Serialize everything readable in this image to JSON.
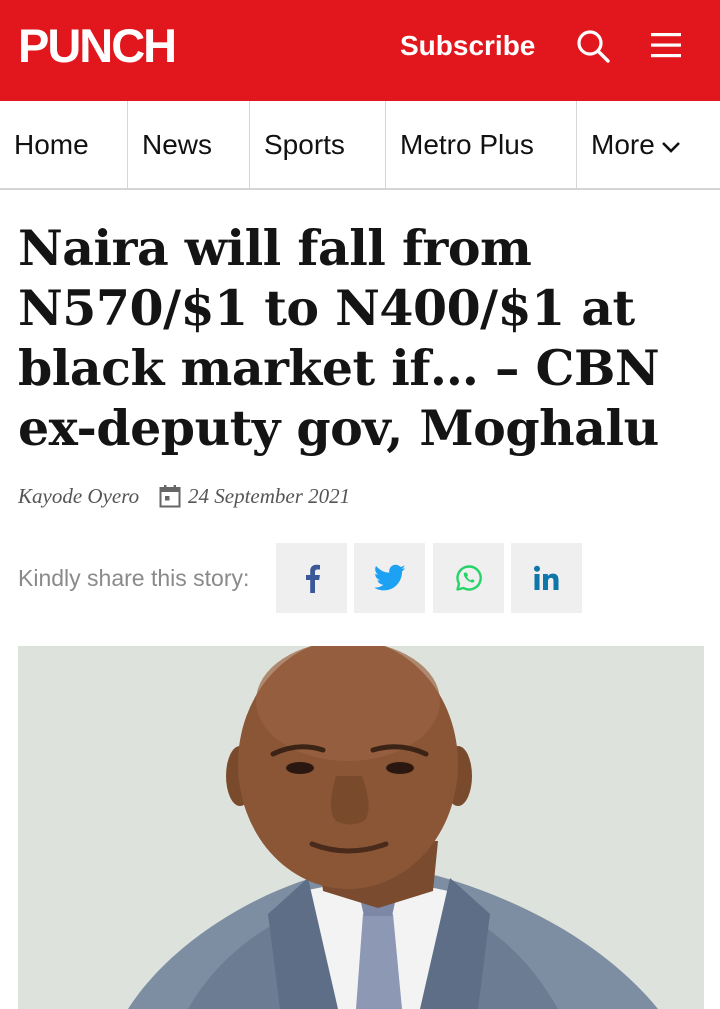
{
  "header": {
    "logo_text": "PUNCH",
    "subscribe_label": "Subscribe",
    "brand_color": "#e2171d",
    "search_icon": "search-icon",
    "menu_icon": "hamburger-menu-icon"
  },
  "nav": {
    "items": [
      {
        "label": "Home"
      },
      {
        "label": "News"
      },
      {
        "label": "Sports"
      },
      {
        "label": "Metro Plus"
      },
      {
        "label": "More"
      }
    ]
  },
  "article": {
    "headline": "Naira will fall from N570/$1 to N400/$1 at black market if… – CBN ex-deputy gov, Moghalu",
    "author": "Kayode Oyero",
    "date": "24 September 2021",
    "share_label": "Kindly share this story:",
    "share_buttons": [
      {
        "icon": "facebook-icon",
        "color": "#3b5998"
      },
      {
        "icon": "twitter-icon",
        "color": "#1da1f2"
      },
      {
        "icon": "whatsapp-icon",
        "color": "#25d366"
      },
      {
        "icon": "linkedin-icon",
        "color": "#0e76a8"
      }
    ]
  }
}
